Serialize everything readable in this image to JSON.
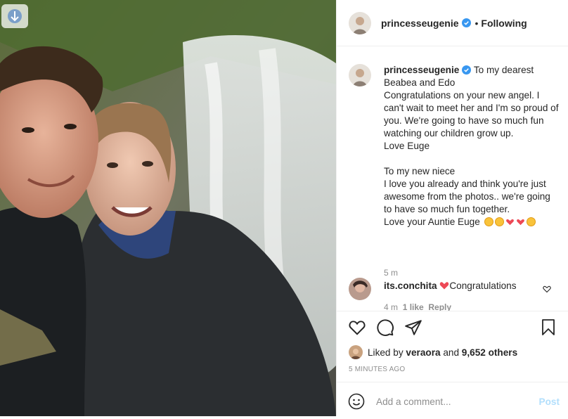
{
  "post": {
    "username": "princesseugenie",
    "following_label": "Following"
  },
  "caption": {
    "username": "princesseugenie",
    "text": "To my dearest\nBeabea and Edo\nCongratulations on your new angel. I can't wait to meet her and I'm so proud of you. We're going to have so much fun watching our children grow up.\nLove Euge\n\nTo my new niece\nI love you already and think you're just awesome from the photos.. we're going to have so much fun together.\nLove your Auntie Euge",
    "emojis": [
      "smiling-face-with-hearts",
      "smiling-face-with-hearts",
      "two-hearts",
      "red-heart",
      "face-blowing-kiss"
    ],
    "time": "5 m"
  },
  "comment": {
    "username": "its.conchita",
    "text": "Congratulations",
    "time": "4 m",
    "likes": "1 like",
    "reply": "Reply"
  },
  "likes": {
    "prefix": "Liked by",
    "user": "veraora",
    "and": "and",
    "count": "9,652 others"
  },
  "timestamp": "5 MINUTES AGO",
  "add_comment": {
    "placeholder": "Add a comment...",
    "post_label": "Post"
  },
  "colors": {
    "verified": "#3897f0",
    "post_disabled": "#b2dffc",
    "heart_red": "#ed4956"
  }
}
